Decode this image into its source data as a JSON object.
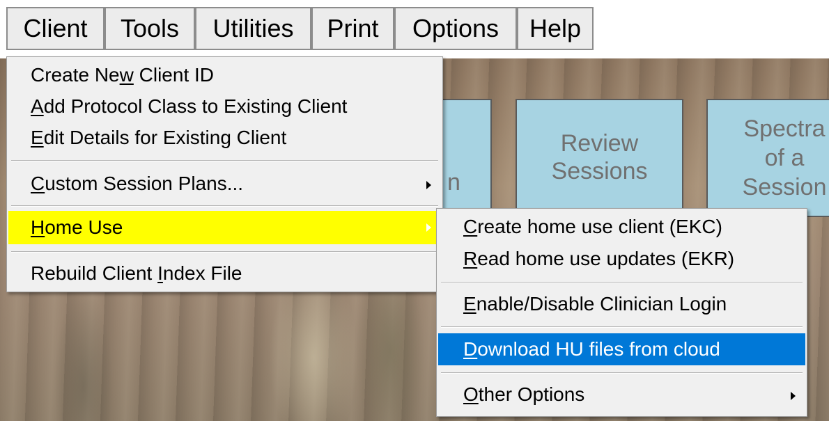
{
  "menubar": {
    "items": [
      {
        "label": "Client"
      },
      {
        "label": "Tools"
      },
      {
        "label": "Utilities"
      },
      {
        "label": "Print"
      },
      {
        "label": "Options"
      },
      {
        "label": "Help"
      }
    ]
  },
  "tiles": {
    "tile1": {
      "label": "n"
    },
    "tile2": {
      "line1": "Review",
      "line2": "Sessions"
    },
    "tile3": {
      "line1": "Spectra",
      "line2": "of a",
      "line3": "Session"
    }
  },
  "client_menu": {
    "items": [
      {
        "pre": "Create Ne",
        "key": "w",
        "post": " Client ID"
      },
      {
        "pre": "",
        "key": "A",
        "post": "dd Protocol Class to Existing Client"
      },
      {
        "pre": "",
        "key": "E",
        "post": "dit Details for Existing Client"
      },
      {
        "pre": "",
        "key": "C",
        "post": "ustom Session Plans..."
      },
      {
        "pre": "",
        "key": "H",
        "post": "ome Use"
      },
      {
        "pre": "Rebuild Client ",
        "key": "I",
        "post": "ndex File"
      }
    ],
    "highlight_color": "#ffff00"
  },
  "home_use_menu": {
    "items": [
      {
        "pre": "",
        "key": "C",
        "post": "reate home use client (EKC)"
      },
      {
        "pre": "",
        "key": "R",
        "post": "ead home use updates (EKR)"
      },
      {
        "pre": "",
        "key": "E",
        "post": "nable/Disable Clinician Login"
      },
      {
        "pre": "",
        "key": "D",
        "post": "ownload HU files from cloud"
      },
      {
        "pre": "",
        "key": "O",
        "post": "ther Options"
      }
    ],
    "highlight_color": "#0078d7"
  }
}
